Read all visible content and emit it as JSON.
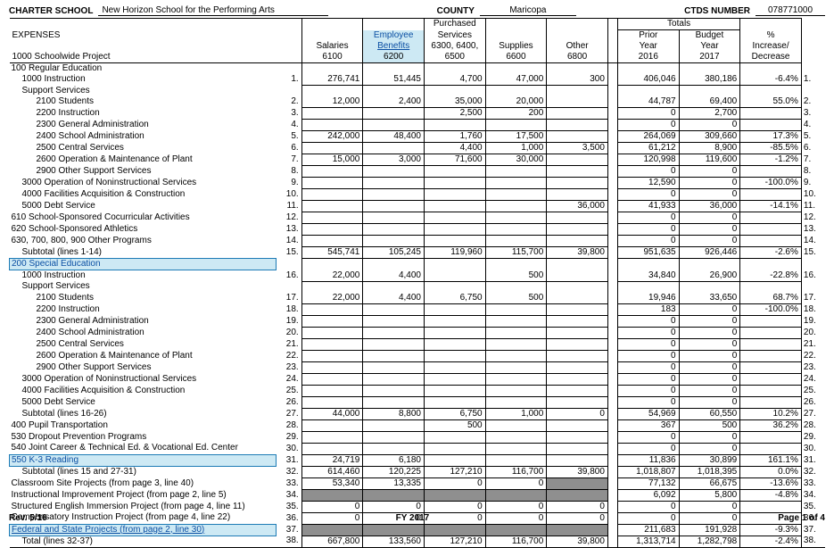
{
  "header": {
    "charter_school_label": "CHARTER SCHOOL",
    "charter_school_name": "New Horizon School for the Performing Arts",
    "county_label": "COUNTY",
    "county_name": "Maricopa",
    "ctds_label": "CTDS NUMBER",
    "ctds_number": "078771000"
  },
  "col_headers": {
    "expenses": "EXPENSES",
    "project": "1000 Schoolwide Project",
    "salaries1": "Salaries",
    "salaries2": "6100",
    "benefits1": "Employee",
    "benefits2": "Benefits",
    "benefits3": "6200",
    "purch1": "Purchased",
    "purch2": "Services",
    "purch3": "6300, 6400,",
    "purch4": "6500",
    "supplies1": "Supplies",
    "supplies2": "6600",
    "other1": "Other",
    "other2": "6800",
    "totals": "Totals",
    "prior1": "Prior",
    "prior2": "Year",
    "prior3": "2016",
    "budget1": "Budget",
    "budget2": "Year",
    "budget3": "2017",
    "pct1": "%",
    "pct2": "Increase/",
    "pct3": "Decrease"
  },
  "rows": [
    {
      "ln": "",
      "r": "",
      "txt": "100 Regular Education",
      "ind": 0
    },
    {
      "ln": "1.",
      "r": "1.",
      "txt": "1000 Instruction",
      "ind": 1,
      "c": [
        "276,741",
        "51,445",
        "4,700",
        "47,000",
        "300",
        "406,046",
        "380,186",
        "-6.4%"
      ]
    },
    {
      "ln": "",
      "r": "",
      "txt": "Support Services",
      "ind": 1
    },
    {
      "ln": "2.",
      "r": "2.",
      "txt": "2100 Students",
      "ind": 2,
      "c": [
        "12,000",
        "2,400",
        "35,000",
        "20,000",
        "",
        "44,787",
        "69,400",
        "55.0%"
      ]
    },
    {
      "ln": "3.",
      "r": "3.",
      "txt": "2200 Instruction",
      "ind": 2,
      "c": [
        "",
        "",
        "2,500",
        "200",
        "",
        "0",
        "2,700",
        ""
      ]
    },
    {
      "ln": "4.",
      "r": "4.",
      "txt": "2300 General Administration",
      "ind": 2,
      "c": [
        "",
        "",
        "",
        "",
        "",
        "0",
        "0",
        ""
      ]
    },
    {
      "ln": "5.",
      "r": "5.",
      "txt": "2400 School Administration",
      "ind": 2,
      "c": [
        "242,000",
        "48,400",
        "1,760",
        "17,500",
        "",
        "264,069",
        "309,660",
        "17.3%"
      ]
    },
    {
      "ln": "6.",
      "r": "6.",
      "txt": "2500 Central Services",
      "ind": 2,
      "c": [
        "",
        "",
        "4,400",
        "1,000",
        "3,500",
        "61,212",
        "8,900",
        "-85.5%"
      ]
    },
    {
      "ln": "7.",
      "r": "7.",
      "txt": "2600 Operation & Maintenance of Plant",
      "ind": 2,
      "c": [
        "15,000",
        "3,000",
        "71,600",
        "30,000",
        "",
        "120,998",
        "119,600",
        "-1.2%"
      ]
    },
    {
      "ln": "8.",
      "r": "8.",
      "txt": "2900 Other Support Services",
      "ind": 2,
      "c": [
        "",
        "",
        "",
        "",
        "",
        "0",
        "0",
        ""
      ]
    },
    {
      "ln": "9.",
      "r": "9.",
      "txt": "3000 Operation of Noninstructional Services",
      "ind": 1,
      "c": [
        "",
        "",
        "",
        "",
        "",
        "12,590",
        "0",
        "-100.0%"
      ]
    },
    {
      "ln": "10.",
      "r": "10.",
      "txt": "4000 Facilities Acquisition & Construction",
      "ind": 1,
      "c": [
        "",
        "",
        "",
        "",
        "",
        "0",
        "0",
        ""
      ]
    },
    {
      "ln": "11.",
      "r": "11.",
      "txt": "5000 Debt Service",
      "ind": 1,
      "c": [
        "",
        "",
        "",
        "",
        "36,000",
        "41,933",
        "36,000",
        "-14.1%"
      ]
    },
    {
      "ln": "12.",
      "r": "12.",
      "txt": "610 School-Sponsored Cocurricular Activities",
      "ind": 0,
      "c": [
        "",
        "",
        "",
        "",
        "",
        "0",
        "0",
        ""
      ]
    },
    {
      "ln": "13.",
      "r": "13.",
      "txt": "620 School-Sponsored Athletics",
      "ind": 0,
      "c": [
        "",
        "",
        "",
        "",
        "",
        "0",
        "0",
        ""
      ]
    },
    {
      "ln": "14.",
      "r": "14.",
      "txt": "630, 700, 800, 900 Other Programs",
      "ind": 0,
      "c": [
        "",
        "",
        "",
        "",
        "",
        "0",
        "0",
        ""
      ]
    },
    {
      "ln": "15.",
      "r": "15.",
      "txt": "Subtotal (lines 1-14)",
      "ind": 1,
      "c": [
        "545,741",
        "105,245",
        "119,960",
        "115,700",
        "39,800",
        "951,635",
        "926,446",
        "-2.6%"
      ],
      "sub": true
    },
    {
      "ln": "",
      "r": "",
      "txt": "200 Special Education",
      "ind": 0,
      "blue": true
    },
    {
      "ln": "16.",
      "r": "16.",
      "txt": "1000 Instruction",
      "ind": 1,
      "c": [
        "22,000",
        "4,400",
        "",
        "500",
        "",
        "34,840",
        "26,900",
        "-22.8%"
      ]
    },
    {
      "ln": "",
      "r": "",
      "txt": "Support Services",
      "ind": 1
    },
    {
      "ln": "17.",
      "r": "17.",
      "txt": "2100 Students",
      "ind": 2,
      "c": [
        "22,000",
        "4,400",
        "6,750",
        "500",
        "",
        "19,946",
        "33,650",
        "68.7%"
      ]
    },
    {
      "ln": "18.",
      "r": "18.",
      "txt": "2200 Instruction",
      "ind": 2,
      "c": [
        "",
        "",
        "",
        "",
        "",
        "183",
        "0",
        "-100.0%"
      ]
    },
    {
      "ln": "19.",
      "r": "19.",
      "txt": "2300 General Administration",
      "ind": 2,
      "c": [
        "",
        "",
        "",
        "",
        "",
        "0",
        "0",
        ""
      ]
    },
    {
      "ln": "20.",
      "r": "20.",
      "txt": "2400 School Administration",
      "ind": 2,
      "c": [
        "",
        "",
        "",
        "",
        "",
        "0",
        "0",
        ""
      ]
    },
    {
      "ln": "21.",
      "r": "21.",
      "txt": "2500 Central Services",
      "ind": 2,
      "c": [
        "",
        "",
        "",
        "",
        "",
        "0",
        "0",
        ""
      ]
    },
    {
      "ln": "22.",
      "r": "22.",
      "txt": "2600 Operation & Maintenance of Plant",
      "ind": 2,
      "c": [
        "",
        "",
        "",
        "",
        "",
        "0",
        "0",
        ""
      ]
    },
    {
      "ln": "23.",
      "r": "23.",
      "txt": "2900 Other Support Services",
      "ind": 2,
      "c": [
        "",
        "",
        "",
        "",
        "",
        "0",
        "0",
        ""
      ]
    },
    {
      "ln": "24.",
      "r": "24.",
      "txt": "3000 Operation of Noninstructional Services",
      "ind": 1,
      "c": [
        "",
        "",
        "",
        "",
        "",
        "0",
        "0",
        ""
      ]
    },
    {
      "ln": "25.",
      "r": "25.",
      "txt": "4000 Facilities Acquisition & Construction",
      "ind": 1,
      "c": [
        "",
        "",
        "",
        "",
        "",
        "0",
        "0",
        ""
      ]
    },
    {
      "ln": "26.",
      "r": "26.",
      "txt": "5000 Debt Service",
      "ind": 1,
      "c": [
        "",
        "",
        "",
        "",
        "",
        "0",
        "0",
        ""
      ]
    },
    {
      "ln": "27.",
      "r": "27.",
      "txt": "Subtotal (lines 16-26)",
      "ind": 1,
      "c": [
        "44,000",
        "8,800",
        "6,750",
        "1,000",
        "0",
        "54,969",
        "60,550",
        "10.2%"
      ],
      "sub": true
    },
    {
      "ln": "28.",
      "r": "28.",
      "txt": "400 Pupil Transportation",
      "ind": 0,
      "c": [
        "",
        "",
        "500",
        "",
        "",
        "367",
        "500",
        "36.2%"
      ]
    },
    {
      "ln": "29.",
      "r": "29.",
      "txt": "530 Dropout Prevention Programs",
      "ind": 0,
      "c": [
        "",
        "",
        "",
        "",
        "",
        "0",
        "0",
        ""
      ]
    },
    {
      "ln": "30.",
      "r": "30.",
      "txt": "540 Joint Career & Technical Ed. & Vocational Ed. Center",
      "ind": 0,
      "c": [
        "",
        "",
        "",
        "",
        "",
        "0",
        "0",
        ""
      ]
    },
    {
      "ln": "31.",
      "r": "31.",
      "txt": "550 K-3 Reading",
      "ind": 0,
      "blue": true,
      "c": [
        "24,719",
        "6,180",
        "",
        "",
        "",
        "11,836",
        "30,899",
        "161.1%"
      ]
    },
    {
      "ln": "32.",
      "r": "32.",
      "txt": "Subtotal (lines 15 and 27-31)",
      "ind": 1,
      "c": [
        "614,460",
        "120,225",
        "127,210",
        "116,700",
        "39,800",
        "1,018,807",
        "1,018,395",
        "0.0%"
      ],
      "sub": true
    },
    {
      "ln": "33.",
      "r": "33.",
      "txt": "Classroom Site Projects (from page 3, line 40)",
      "ind": 0,
      "c": [
        "53,340",
        "13,335",
        "0",
        "0",
        "G",
        "77,132",
        "66,675",
        "-13.6%"
      ]
    },
    {
      "ln": "34.",
      "r": "34.",
      "txt": "Instructional Improvement Project (from page 2, line 5)",
      "ind": 0,
      "c": [
        "G",
        "G",
        "G",
        "G",
        "G",
        "6,092",
        "5,800",
        "-4.8%"
      ]
    },
    {
      "ln": "35.",
      "r": "35.",
      "txt": "Structured English Immersion Project (from page 4, line 11)",
      "ind": 0,
      "c": [
        "0",
        "0",
        "0",
        "0",
        "0",
        "0",
        "0",
        ""
      ]
    },
    {
      "ln": "36.",
      "r": "36.",
      "txt": "Compensatory Instruction Project (from page 4, line 22)",
      "ind": 0,
      "c": [
        "0",
        "0",
        "0",
        "0",
        "0",
        "0",
        "0",
        ""
      ]
    },
    {
      "ln": "37.",
      "r": "37.",
      "txt": "Federal and State Projects (from page 2, line 30)",
      "ind": 0,
      "blue": true,
      "c": [
        "G",
        "G",
        "G",
        "G",
        "G",
        "211,683",
        "191,928",
        "-9.3%"
      ]
    },
    {
      "ln": "38.",
      "r": "38.",
      "txt": "Total (lines 32-37)",
      "ind": 1,
      "c": [
        "667,800",
        "133,560",
        "127,210",
        "116,700",
        "39,800",
        "1,313,714",
        "1,282,798",
        "-2.4%"
      ],
      "sub": true
    }
  ],
  "footer": {
    "rev": "Rev. 5/16",
    "fy": "FY 2017",
    "page": "Page  1 of 4"
  }
}
